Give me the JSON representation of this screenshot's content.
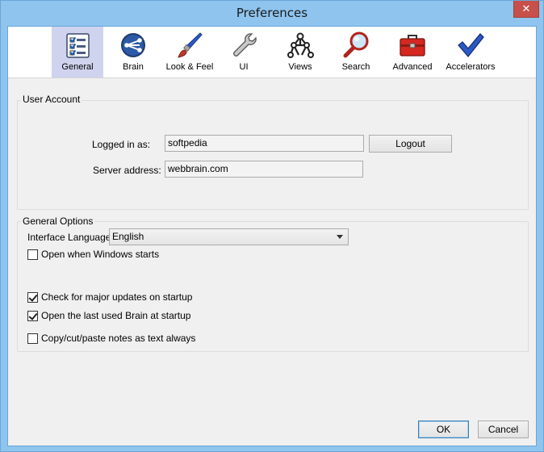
{
  "window": {
    "title": "Preferences",
    "close_glyph": "✕"
  },
  "toolbar": {
    "items": [
      {
        "label": "General",
        "icon": "checklist-icon",
        "active": true
      },
      {
        "label": "Brain",
        "icon": "brain-icon"
      },
      {
        "label": "Look & Feel",
        "icon": "paintbrush-icon"
      },
      {
        "label": "UI",
        "icon": "wrench-icon"
      },
      {
        "label": "Views",
        "icon": "network-icon"
      },
      {
        "label": "Search",
        "icon": "magnifier-icon"
      },
      {
        "label": "Advanced",
        "icon": "toolbox-icon"
      },
      {
        "label": "Accelerators",
        "icon": "checkmark-icon"
      }
    ]
  },
  "user_account": {
    "title": "User Account",
    "logged_in_label": "Logged in as:",
    "logged_in_value": "softpedia",
    "logout_label": "Logout",
    "server_label": "Server address:",
    "server_value": "webbrain.com"
  },
  "general_options": {
    "title": "General Options",
    "language_label": "Interface Language",
    "language_value": "English",
    "checkboxes": [
      {
        "label": "Open when Windows starts",
        "checked": false
      },
      {
        "label": "Check for major updates on startup",
        "checked": true
      },
      {
        "label": "Open the last used Brain at startup",
        "checked": true
      },
      {
        "label": "Copy/cut/paste notes as text always",
        "checked": false
      }
    ]
  },
  "footer": {
    "ok_label": "OK",
    "cancel_label": "Cancel"
  }
}
